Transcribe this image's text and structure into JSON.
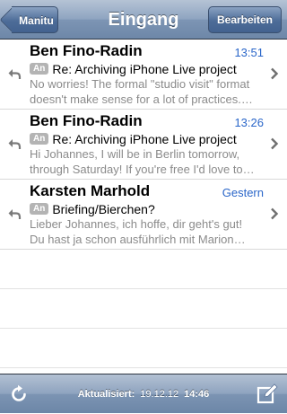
{
  "navbar": {
    "title": "Eingang",
    "back_label": "Manitu",
    "edit_label": "Bearbeiten"
  },
  "colors": {
    "accent_time": "#2a66c9",
    "navbar": "#7d95b4",
    "badge": "#b4b4b4"
  },
  "messages": [
    {
      "sender": "Ben Fino-Radin",
      "time": "13:51",
      "badge": "An",
      "subject": "Re: Archiving iPhone Live project",
      "preview_line1": "No worries! The formal \"studio visit\" format",
      "preview_line2": "doesn't make sense for a lot of practices.…",
      "status_icon": "reply-arrow-icon"
    },
    {
      "sender": "Ben Fino-Radin",
      "time": "13:26",
      "badge": "An",
      "subject": "Re: Archiving iPhone Live project",
      "preview_line1": "Hi Johannes, I will be in Berlin tomorrow,",
      "preview_line2": "through Saturday! If you're free I'd love to…",
      "status_icon": "reply-arrow-icon"
    },
    {
      "sender": "Karsten Marhold",
      "time": "Gestern",
      "badge": "An",
      "subject": "Briefing/Bierchen?",
      "preview_line1": "Lieber Johannes, ich hoffe, dir geht's gut!",
      "preview_line2": "Du hast ja schon ausführlich mit Marion…",
      "status_icon": "reply-arrow-icon"
    }
  ],
  "toolbar": {
    "updated_label": "Aktualisiert:",
    "updated_date": "19.12.12",
    "updated_time": "14:46",
    "left_icon": "refresh-icon",
    "right_icon": "compose-icon"
  }
}
